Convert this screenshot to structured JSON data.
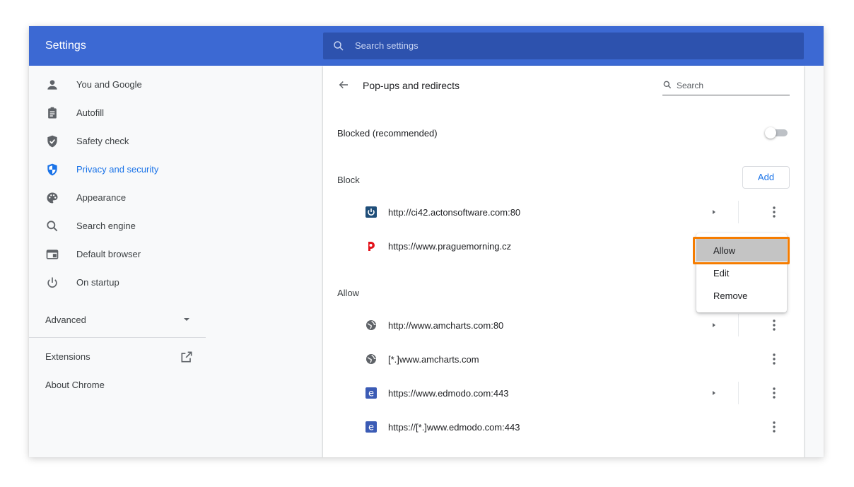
{
  "app": {
    "title": "Settings",
    "search_placeholder": "Search settings"
  },
  "sidebar": {
    "items": [
      {
        "label": "You and Google",
        "icon": "person-icon"
      },
      {
        "label": "Autofill",
        "icon": "clipboard-icon"
      },
      {
        "label": "Safety check",
        "icon": "shield-check-icon"
      },
      {
        "label": "Privacy and security",
        "icon": "shield-icon",
        "active": true
      },
      {
        "label": "Appearance",
        "icon": "palette-icon"
      },
      {
        "label": "Search engine",
        "icon": "search-icon"
      },
      {
        "label": "Default browser",
        "icon": "browser-icon"
      },
      {
        "label": "On startup",
        "icon": "power-icon"
      }
    ],
    "advanced_label": "Advanced",
    "extensions_label": "Extensions",
    "about_label": "About Chrome"
  },
  "page": {
    "title": "Pop-ups and redirects",
    "search_placeholder": "Search",
    "toggle_label": "Blocked (recommended)",
    "toggle_on": false,
    "block_label": "Block",
    "add_label": "Add",
    "allow_label": "Allow",
    "block_sites": [
      {
        "url": "http://ci42.actonsoftware.com:80",
        "icon": "acton-favicon"
      },
      {
        "url": "https://www.praguemorning.cz",
        "icon": "praguemorning-favicon"
      }
    ],
    "allow_sites": [
      {
        "url": "http://www.amcharts.com:80",
        "icon": "globe-icon"
      },
      {
        "url": "[*.]www.amcharts.com",
        "icon": "globe-icon"
      },
      {
        "url": "https://www.edmodo.com:443",
        "icon": "edmodo-favicon"
      },
      {
        "url": "https://[*.]www.edmodo.com:443",
        "icon": "edmodo-favicon"
      }
    ]
  },
  "context_menu": {
    "items": [
      "Allow",
      "Edit",
      "Remove"
    ],
    "highlighted": "Allow"
  },
  "colors": {
    "header": "#3c69d3",
    "accent": "#1a73e8",
    "highlight_frame": "#f57c00"
  }
}
